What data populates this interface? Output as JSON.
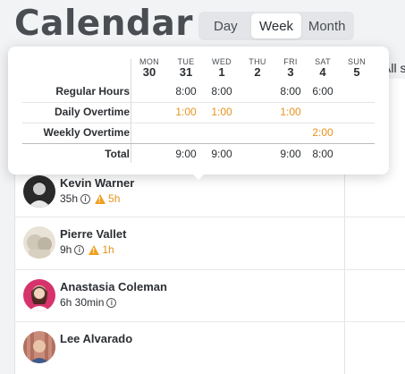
{
  "header": {
    "title": "Calendar",
    "views": [
      {
        "label": "Day",
        "active": false
      },
      {
        "label": "Week",
        "active": true
      },
      {
        "label": "Month",
        "active": false
      }
    ],
    "right_text": "All s"
  },
  "tooltip": {
    "days": [
      {
        "dow": "MON",
        "num": "30"
      },
      {
        "dow": "TUE",
        "num": "31"
      },
      {
        "dow": "WED",
        "num": "1"
      },
      {
        "dow": "THU",
        "num": "2"
      },
      {
        "dow": "FRI",
        "num": "3"
      },
      {
        "dow": "SAT",
        "num": "4"
      },
      {
        "dow": "SUN",
        "num": "5"
      }
    ],
    "rows": [
      {
        "label": "Regular Hours",
        "values": [
          "",
          "8:00",
          "8:00",
          "",
          "8:00",
          "6:00",
          ""
        ]
      },
      {
        "label": "Daily Overtime",
        "values": [
          "",
          "1:00",
          "1:00",
          "",
          "1:00",
          "",
          ""
        ]
      },
      {
        "label": "Weekly Overtime",
        "values": [
          "",
          "",
          "",
          "",
          "",
          "2:00",
          ""
        ]
      },
      {
        "label": "Total",
        "values": [
          "",
          "9:00",
          "9:00",
          "",
          "9:00",
          "8:00",
          ""
        ]
      }
    ]
  },
  "employees": [
    {
      "name": "Kevin Warner",
      "hours": "35h",
      "warning": "5h"
    },
    {
      "name": "Pierre Vallet",
      "hours": "9h",
      "warning": "1h"
    },
    {
      "name": "Anastasia Coleman",
      "hours": "6h 30min",
      "warning": ""
    },
    {
      "name": "Lee Alvarado",
      "hours": "",
      "warning": ""
    }
  ],
  "colors": {
    "warning": "#e8921c",
    "accent_text": "#2c2f33",
    "background": "#f2f3f5"
  }
}
